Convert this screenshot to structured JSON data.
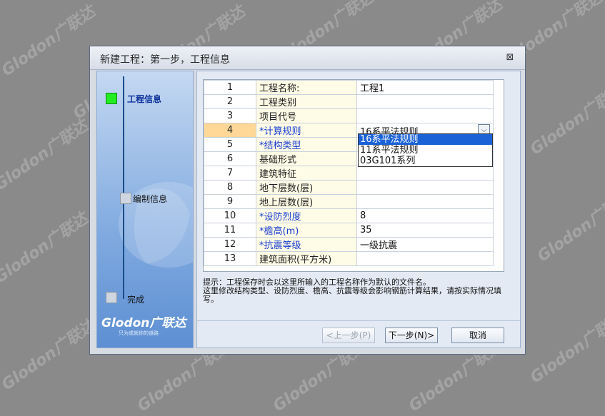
{
  "watermark": "Glodon广联达",
  "dialog": {
    "title": "新建工程：第一步，工程信息",
    "close_glyph": "⊠"
  },
  "sidebar": {
    "steps": [
      {
        "label": "工程信息",
        "active": true
      },
      {
        "label": "编制信息",
        "active": false
      },
      {
        "label": "完成",
        "active": false
      }
    ],
    "logo_text": "Glodon广联达",
    "slogan": "只为成就你的道路"
  },
  "grid": {
    "rows": [
      {
        "num": "1",
        "label": "工程名称:",
        "value": "工程1",
        "required": false
      },
      {
        "num": "2",
        "label": "工程类别",
        "value": "",
        "required": false
      },
      {
        "num": "3",
        "label": "项目代号",
        "value": "",
        "required": false
      },
      {
        "num": "4",
        "label": "*计算规则",
        "value": "16系平法规则",
        "required": true
      },
      {
        "num": "5",
        "label": "*结构类型",
        "value": "",
        "required": true
      },
      {
        "num": "6",
        "label": "基础形式",
        "value": "",
        "required": false
      },
      {
        "num": "7",
        "label": "建筑特征",
        "value": "",
        "required": false
      },
      {
        "num": "8",
        "label": "地下层数(层)",
        "value": "",
        "required": false
      },
      {
        "num": "9",
        "label": "地上层数(层)",
        "value": "",
        "required": false
      },
      {
        "num": "10",
        "label": "*设防烈度",
        "value": "8",
        "required": true
      },
      {
        "num": "11",
        "label": "*檐高(m)",
        "value": "35",
        "required": true
      },
      {
        "num": "12",
        "label": "*抗震等级",
        "value": "一级抗震",
        "required": true
      },
      {
        "num": "13",
        "label": "建筑面积(平方米)",
        "value": "",
        "required": false
      }
    ],
    "active_row_num": "4",
    "combo_arrow": "⌵",
    "dropdown_options": [
      "16系平法规则",
      "11系平法规则",
      "03G101系列"
    ],
    "dropdown_selected_index": 0
  },
  "hint": {
    "line1": "提示：工程保存时会以这里所输入的工程名称作为默认的文件名。",
    "line2": "这里修改结构类型、设防烈度、檐高、抗震等级会影响钢筋计算结果，请按实际情况填写。"
  },
  "buttons": {
    "prev": "<上一步(P)",
    "next": "下一步(N)>",
    "cancel": "取消"
  },
  "colors": {
    "active_row": "#ffd796",
    "label_bg": "#fefbe6",
    "required_text": "#1a3fd1",
    "step_active": "#22ee22",
    "step_inactive": "#cfd6df",
    "dropdown_selected": "#1b62d6"
  }
}
